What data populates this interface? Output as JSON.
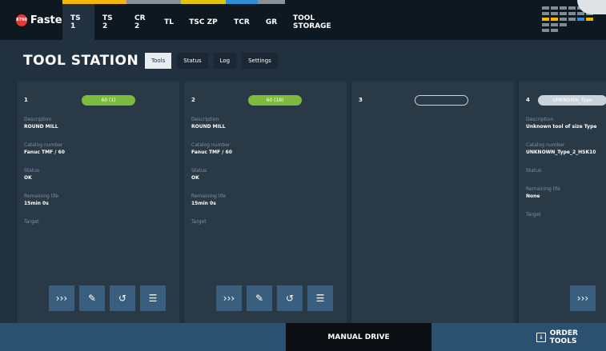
{
  "app": {
    "logo_badge": "8760",
    "logo_text": "Fastems"
  },
  "nav": {
    "tabs": [
      {
        "label": "TS 1"
      },
      {
        "label": "TS 2"
      },
      {
        "label": "CR 2"
      },
      {
        "label": "TL"
      },
      {
        "label": "TSC ZP"
      },
      {
        "label": "TCR"
      },
      {
        "label": "GR"
      },
      {
        "label": "TOOL STORAGE"
      }
    ]
  },
  "header": {
    "title": "TOOL STATION 1",
    "subtabs": [
      {
        "label": "Tools"
      },
      {
        "label": "Status"
      },
      {
        "label": "Log"
      },
      {
        "label": "Settings"
      }
    ]
  },
  "cards": [
    {
      "num": "1",
      "pill": "60 (1)",
      "desc_k": "Description",
      "desc_v": "ROUND MILL",
      "cat_k": "Catalog number",
      "cat_v": "Fanuc TMF / 60",
      "status_k": "Status",
      "status_v": "OK",
      "life_k": "Remaining life",
      "life_v": "15min 0s",
      "target_k": "Target"
    },
    {
      "num": "2",
      "pill": "60 (18)",
      "desc_k": "Description",
      "desc_v": "ROUND MILL",
      "cat_k": "Catalog number",
      "cat_v": "Fanuc TMF / 60",
      "status_k": "Status",
      "status_v": "OK",
      "life_k": "Remaining life",
      "life_v": "15min 0s",
      "target_k": "Target"
    },
    {
      "num": "3",
      "pill": ""
    },
    {
      "num": "4",
      "pill": "UNKNOWN_Type",
      "desc_k": "Description",
      "desc_v": "Unknown tool of size Type",
      "cat_k": "Catalog number",
      "cat_v": "UNKNOWN_Type_2_HSK10",
      "status_k": "Status",
      "life_k": "Remaining life",
      "life_v": "None",
      "target_k": "Target"
    }
  ],
  "actions": {
    "icons": [
      "forward-icon",
      "wrench-icon",
      "reset-history-icon",
      "add-list-icon"
    ]
  },
  "bottom": {
    "manual": "MANUAL DRIVE",
    "order": "ORDER TOOLS"
  },
  "colors": {
    "accent_yellow": "#f5b800",
    "accent_blue": "#2f8fd6",
    "ok_green": "#7dbb3f"
  }
}
